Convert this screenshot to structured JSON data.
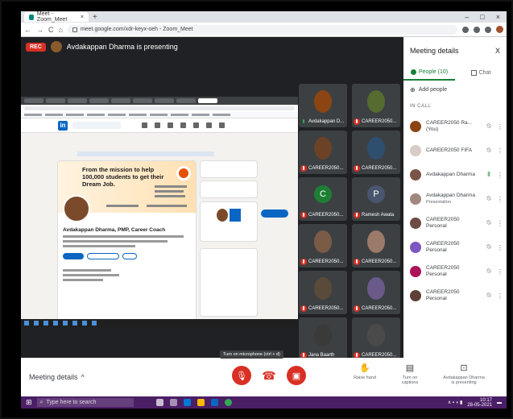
{
  "browser": {
    "tab_title": "Meet - Zoom_Meet",
    "tab_close": "×",
    "new_tab": "+",
    "window_controls": [
      "–",
      "□",
      "×"
    ],
    "back": "←",
    "forward": "→",
    "reload": "C",
    "home": "⌂",
    "url": "meet.google.com/xdr-keyx-oeh - Zoom_Meet"
  },
  "presentation": {
    "rec_label": "REC",
    "presenter_text": "Avdakappan Dharma is presenting"
  },
  "shared_screen": {
    "linkedin_logo": "in",
    "cover_title": "From the mission to help 100,000 students to get their Dream Job.",
    "profile_name": "Avdakappan Dharma, PMP, Career Coach"
  },
  "participants": [
    {
      "name": "Avdakappan D...",
      "mic": "on",
      "photo_color": "#8b4513"
    },
    {
      "name": "CAREER2050...",
      "mic": "muted",
      "photo_color": "#556b2f"
    },
    {
      "name": "CAREER2050...",
      "mic": "muted",
      "photo_color": "#6b4226"
    },
    {
      "name": "CAREER2050...",
      "mic": "muted",
      "photo_color": "#2f4f6f"
    },
    {
      "name": "CAREER2050...",
      "mic": "muted",
      "letter": "C",
      "letter_color": "#1e7e34"
    },
    {
      "name": "Ramesh Awata",
      "mic": "muted",
      "letter": "P",
      "letter_color": "#4a5670"
    },
    {
      "name": "CAREER2050...",
      "mic": "muted",
      "photo_color": "#7a5b45"
    },
    {
      "name": "CAREER2050...",
      "mic": "muted",
      "photo_color": "#9b7a6a"
    },
    {
      "name": "CAREER2050...",
      "mic": "muted",
      "photo_color": "#5a4a3a"
    },
    {
      "name": "CAREER2050...",
      "mic": "muted",
      "photo_color": "#6a5a8a"
    },
    {
      "name": "Jana Baarth",
      "mic": "muted",
      "photo_color": "#3a3a3a"
    },
    {
      "name": "CAREER2050...",
      "mic": "muted",
      "photo_color": "#4a4a4a"
    }
  ],
  "panel": {
    "title": "Meeting details",
    "close": "X",
    "tab_people": "People (10)",
    "tab_chat": "Chat",
    "add_people": "Add people",
    "section": "IN CALL",
    "people": [
      {
        "name": "CAREER2050 Ra... (You)",
        "sub": "",
        "color": "#8b4513",
        "mic": "muted"
      },
      {
        "name": "CAREER2050 FIFA",
        "sub": "",
        "color": "#d7ccc8",
        "mic": "muted"
      },
      {
        "name": "Avdakappan Dharma",
        "sub": "",
        "color": "#795548",
        "mic": "on"
      },
      {
        "name": "Avdakappan Dharma",
        "sub": "Presentation",
        "color": "#a1887f",
        "mic": "muted"
      },
      {
        "name": "CAREER2050 Personal",
        "sub": "",
        "color": "#6d4c41",
        "mic": "muted"
      },
      {
        "name": "CAREER2050 Personal",
        "sub": "",
        "color": "#7e57c2",
        "mic": "muted"
      },
      {
        "name": "CAREER2050 Personal",
        "sub": "",
        "color": "#ad1457",
        "mic": "muted"
      },
      {
        "name": "CAREER2050 Personal",
        "sub": "",
        "color": "#5d4037",
        "mic": "muted"
      }
    ]
  },
  "bottom": {
    "meeting_details": "Meeting details",
    "tooltip": "Turn on microphone (ctrl + d)",
    "raise_hand": "Raise hand",
    "turn_on_captions": "Turn on captions",
    "presenting_label": "Avdakappan Dharma is presenting"
  },
  "taskbar": {
    "search_placeholder": "Type here to search",
    "time": "10:17",
    "date": "28-05-2021"
  },
  "colors": {
    "meet_bg": "#202124",
    "danger": "#d93025",
    "accent": "#188038",
    "taskbar": "#4b1f66"
  }
}
